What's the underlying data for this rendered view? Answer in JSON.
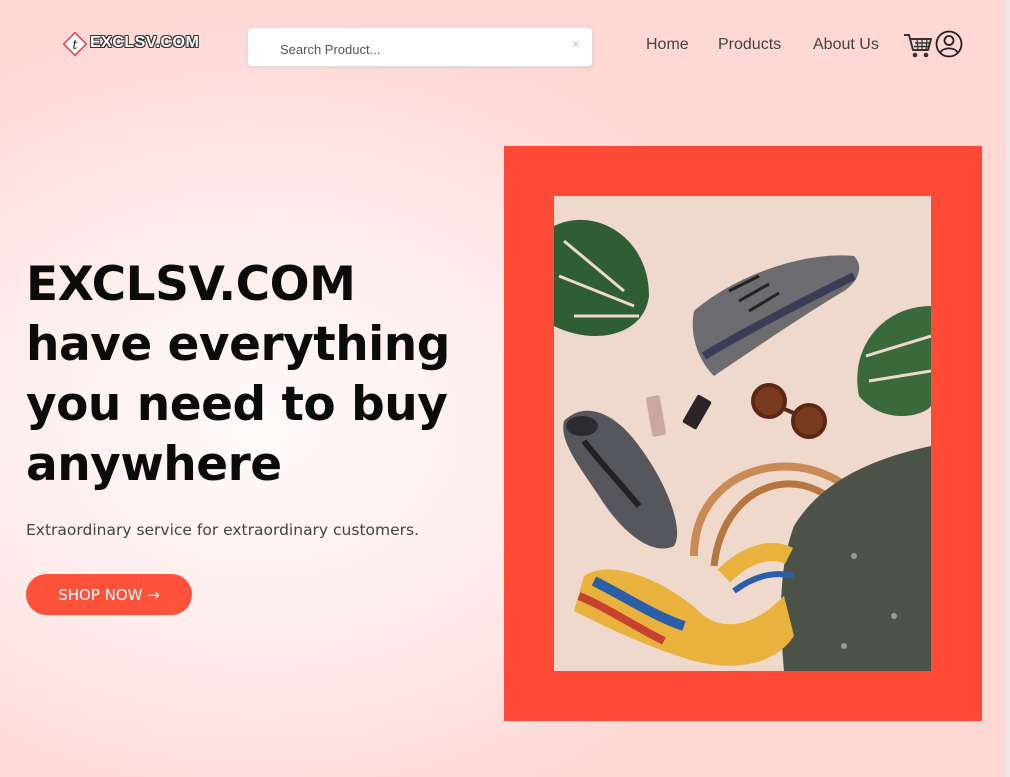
{
  "brand": {
    "logo_letter": "t",
    "logo_text": "EXCLSV.COM"
  },
  "search": {
    "placeholder": "Search Product...",
    "clear_glyph": "×"
  },
  "nav": {
    "items": [
      {
        "label": "Home"
      },
      {
        "label": "Products"
      },
      {
        "label": "About Us"
      }
    ]
  },
  "icons": {
    "cart": "cart-icon",
    "user": "user-icon"
  },
  "hero": {
    "title_lines": [
      "EXCLSV.COM",
      "have everything",
      "you need to buy",
      "anywhere"
    ],
    "subtitle": "Extraordinary service for extraordinary customers.",
    "cta_label": "SHOP NOW →"
  },
  "colors": {
    "accent": "#ff523b",
    "frame": "#ff4b36",
    "photo_bg": "#efd9cd",
    "text_dark": "#0b0b0b"
  }
}
